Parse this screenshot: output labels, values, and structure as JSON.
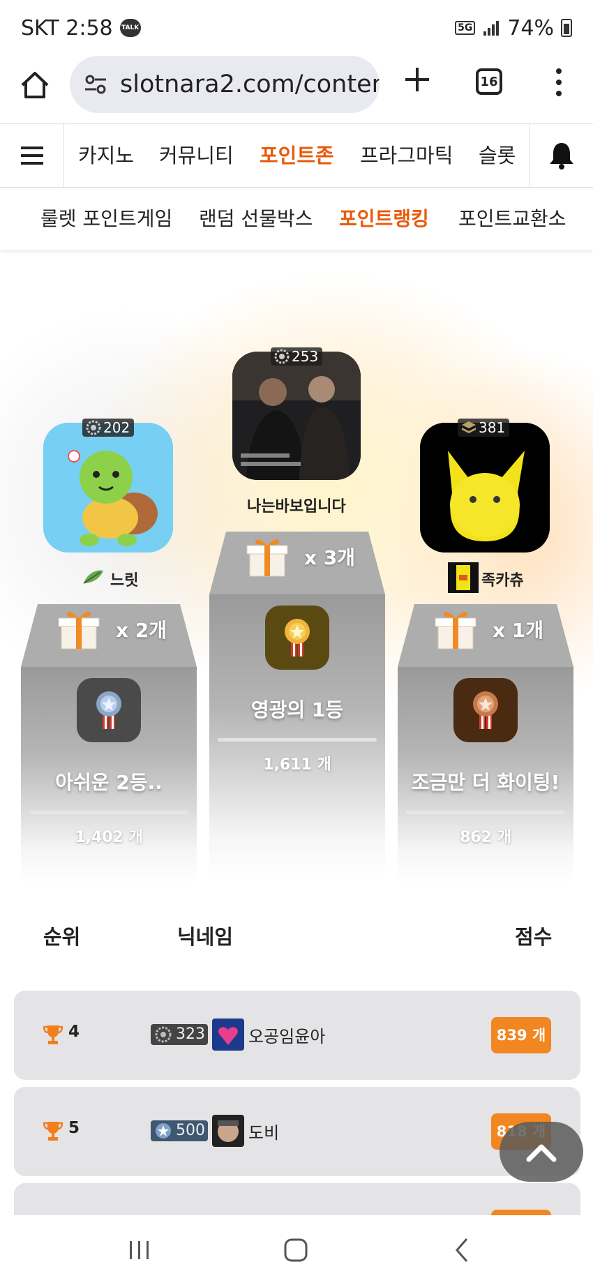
{
  "status_bar": {
    "carrier_time": "SKT 2:58",
    "talk_badge": "TALK",
    "network": "5G",
    "battery": "74%"
  },
  "browser": {
    "url": "slotnara2.com/conten",
    "tab_count": "16"
  },
  "main_nav": {
    "items": [
      "카지노",
      "커뮤니티",
      "포인트존",
      "프라그마틱",
      "슬롯"
    ],
    "active": "포인트존"
  },
  "sub_nav": {
    "items": [
      "룰렛 포인트게임",
      "랜덤 선물박스",
      "포인트랭킹",
      "포인트교환소"
    ],
    "active": "포인트랭킹"
  },
  "podium": {
    "first": {
      "level": "253",
      "name": "나는바보입니다",
      "gift_count": "x 3개",
      "title": "영광의 1등",
      "score": "1,611 개"
    },
    "second": {
      "level": "202",
      "name": "느릿",
      "gift_count": "x 2개",
      "title": "아쉬운 2등..",
      "score": "1,402 개"
    },
    "third": {
      "level": "381",
      "name": "족카츄",
      "gift_count": "x 1개",
      "title": "조금만 더 화이팅!",
      "score": "862 개"
    }
  },
  "ranking": {
    "headers": {
      "rank": "순위",
      "nickname": "닉네임",
      "score": "점수"
    },
    "rows": [
      {
        "rank": "4",
        "level": "323",
        "nickname": "오공임윤아",
        "score": "839 개"
      },
      {
        "rank": "5",
        "level": "500",
        "nickname": "도비",
        "score": "818 개"
      }
    ]
  },
  "colors": {
    "accent": "#e95a0c",
    "score_badge": "#f28620",
    "podium_gray": "#9a9a9a"
  }
}
